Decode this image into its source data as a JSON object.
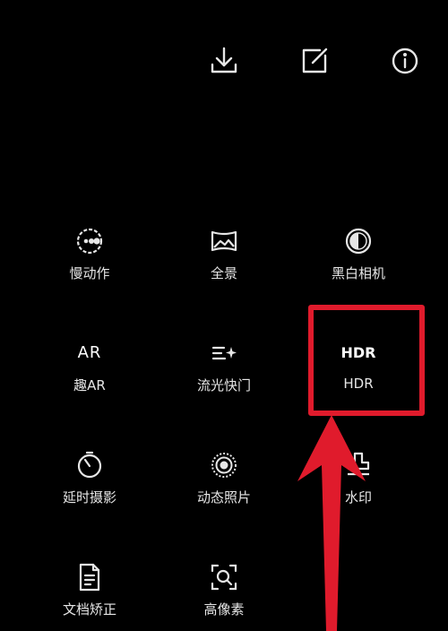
{
  "topbar": {
    "icons": [
      "download-icon",
      "edit-icon",
      "info-icon"
    ]
  },
  "modes": [
    {
      "id": "slow-motion",
      "label": "慢动作",
      "icon": "slow-motion-icon"
    },
    {
      "id": "panorama",
      "label": "全景",
      "icon": "panorama-icon"
    },
    {
      "id": "monochrome",
      "label": "黑白相机",
      "icon": "monochrome-icon"
    },
    {
      "id": "fun-ar",
      "label": "趣AR",
      "icon": "ar-icon",
      "glyph": "AR"
    },
    {
      "id": "light-painting",
      "label": "流光快门",
      "icon": "light-painting-icon"
    },
    {
      "id": "hdr",
      "label": "HDR",
      "icon": "hdr-icon",
      "glyph": "HDR"
    },
    {
      "id": "time-lapse",
      "label": "延时摄影",
      "icon": "time-lapse-icon"
    },
    {
      "id": "moving-picture",
      "label": "动态照片",
      "icon": "moving-picture-icon"
    },
    {
      "id": "watermark",
      "label": "水印",
      "icon": "watermark-icon"
    },
    {
      "id": "document-scan",
      "label": "文档矫正",
      "icon": "document-icon"
    },
    {
      "id": "high-res",
      "label": "高像素",
      "icon": "high-res-icon"
    }
  ],
  "annotation": {
    "highlight_color": "#e01b2c",
    "target": "hdr"
  }
}
